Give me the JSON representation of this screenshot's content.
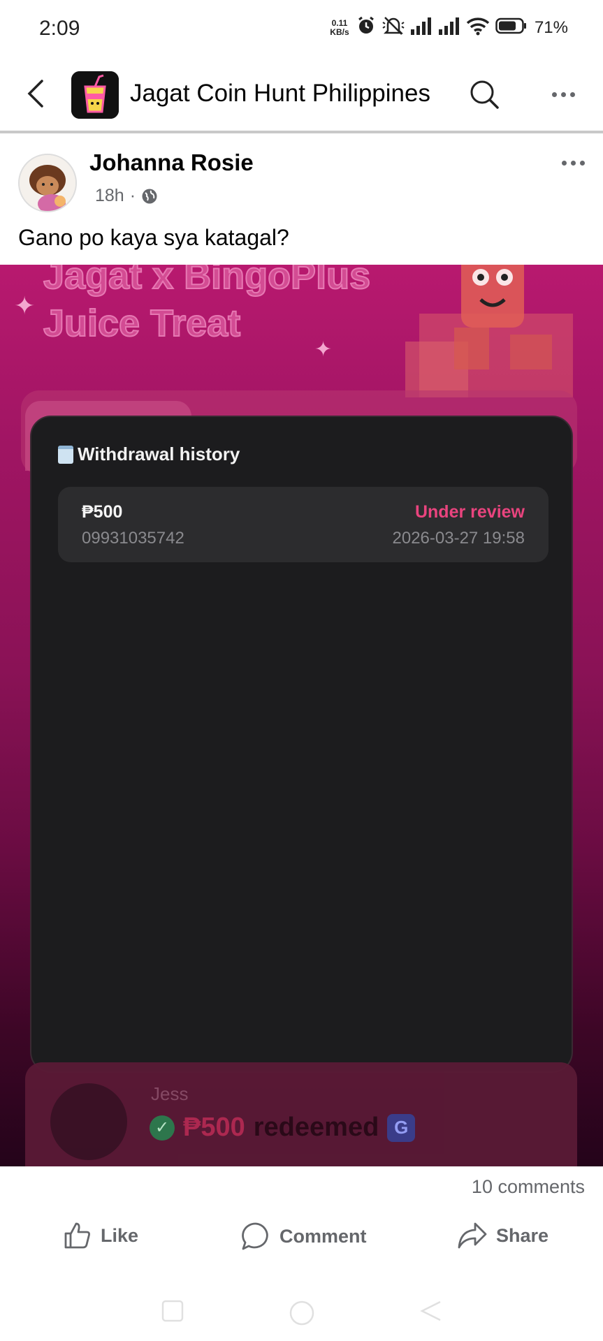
{
  "status_bar": {
    "time": "2:09",
    "net_speed_value": "0.11",
    "net_speed_unit": "KB/s",
    "battery": "71%",
    "icons": [
      "alarm-icon",
      "mute-icon",
      "signal-icon",
      "signal-icon",
      "wifi-icon",
      "battery-icon"
    ]
  },
  "header": {
    "title": "Jagat Coin Hunt Philippines",
    "icons": [
      "back-arrow-icon",
      "search-icon",
      "more-icon"
    ]
  },
  "post": {
    "author": "Johanna Rosie",
    "time": "18h",
    "separator": "·",
    "audience_icon": "globe-icon",
    "text": "Gano po kaya sya katagal?",
    "image": {
      "promo_title_line1": "Jagat x BingoPlus",
      "promo_title_line2": "Juice Treat",
      "withdrawal_card": {
        "title": "Withdrawal history",
        "rows": [
          {
            "amount": "₱500",
            "phone": "09931035742",
            "status": "Under review",
            "datetime": "2026-03-27 19:58"
          }
        ]
      },
      "redeem_panel": {
        "name": "Jess",
        "amount": "₱500",
        "text": "redeemed",
        "badge": "G"
      }
    },
    "comments_count": "10 comments",
    "actions": {
      "like": "Like",
      "comment": "Comment",
      "share": "Share"
    }
  },
  "colors": {
    "status_under_review": "#e9447e",
    "image_bg_top": "#b8196f",
    "card_bg": "#1c1c1e"
  }
}
